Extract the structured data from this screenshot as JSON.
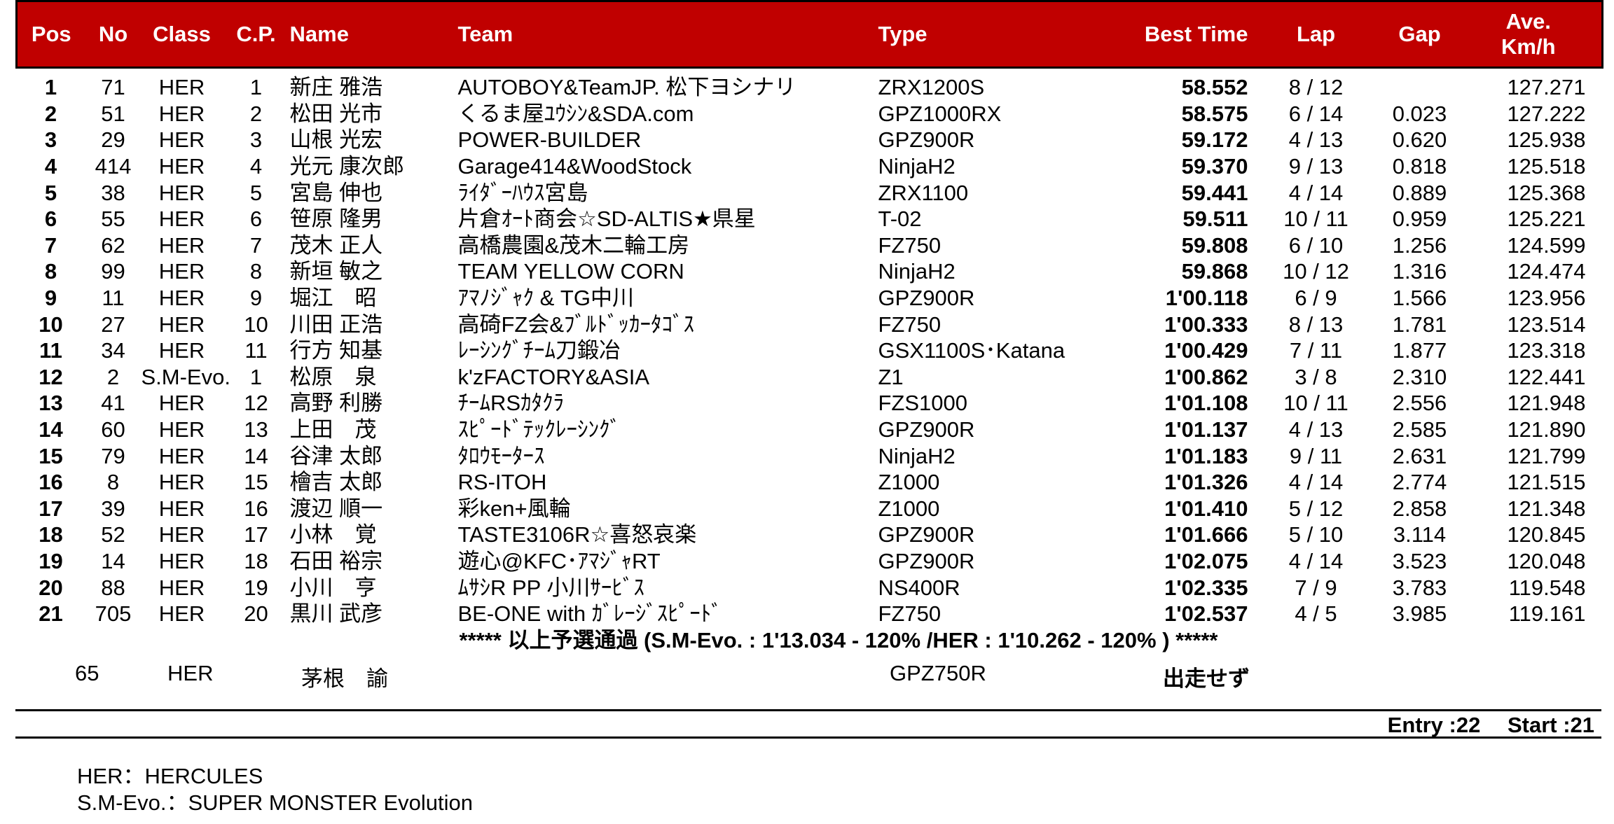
{
  "headers": {
    "pos": "Pos",
    "no": "No",
    "class": "Class",
    "cp": "C.P.",
    "name": "Name",
    "team": "Team",
    "type": "Type",
    "best_time": "Best Time",
    "lap": "Lap",
    "gap": "Gap",
    "avg_kmh_line1": "Ave.",
    "avg_kmh_line2": "Km/h"
  },
  "colors": {
    "header_bg": "#c00000",
    "header_text": "#ffffff"
  },
  "rows": [
    {
      "pos": "1",
      "no": "71",
      "cls": "HER",
      "cp": "1",
      "name": "新庄 雅浩",
      "team": "AUTOBOY&TeamJP. 松下ヨシナリ",
      "type": "ZRX1200S",
      "best": "58.552",
      "lap": "8 / 12",
      "gap": "",
      "avg": "127.271"
    },
    {
      "pos": "2",
      "no": "51",
      "cls": "HER",
      "cp": "2",
      "name": "松田 光市",
      "team": "くるま屋ﾕｳｼﾝ&SDA.com",
      "type": "GPZ1000RX",
      "best": "58.575",
      "lap": "6 / 14",
      "gap": "0.023",
      "avg": "127.222"
    },
    {
      "pos": "3",
      "no": "29",
      "cls": "HER",
      "cp": "3",
      "name": "山根 光宏",
      "team": "POWER-BUILDER",
      "type": "GPZ900R",
      "best": "59.172",
      "lap": "4 / 13",
      "gap": "0.620",
      "avg": "125.938"
    },
    {
      "pos": "4",
      "no": "414",
      "cls": "HER",
      "cp": "4",
      "name": "光元 康次郎",
      "team": "Garage414&WoodStock",
      "type": "NinjaH2",
      "best": "59.370",
      "lap": "9 / 13",
      "gap": "0.818",
      "avg": "125.518"
    },
    {
      "pos": "5",
      "no": "38",
      "cls": "HER",
      "cp": "5",
      "name": "宮島 伸也",
      "team": "ﾗｲﾀﾞｰﾊｳｽ宮島",
      "type": "ZRX1100",
      "best": "59.441",
      "lap": "4 / 14",
      "gap": "0.889",
      "avg": "125.368"
    },
    {
      "pos": "6",
      "no": "55",
      "cls": "HER",
      "cp": "6",
      "name": "笹原 隆男",
      "team": "片倉ｵｰﾄ商会☆SD-ALTIS★県星",
      "type": "T-02",
      "best": "59.511",
      "lap": "10 / 11",
      "gap": "0.959",
      "avg": "125.221"
    },
    {
      "pos": "7",
      "no": "62",
      "cls": "HER",
      "cp": "7",
      "name": "茂木 正人",
      "team": "高橋農園&茂木二輪工房",
      "type": "FZ750",
      "best": "59.808",
      "lap": "6 / 10",
      "gap": "1.256",
      "avg": "124.599"
    },
    {
      "pos": "8",
      "no": "99",
      "cls": "HER",
      "cp": "8",
      "name": "新垣 敏之",
      "team": "TEAM YELLOW CORN",
      "type": "NinjaH2",
      "best": "59.868",
      "lap": "10 / 12",
      "gap": "1.316",
      "avg": "124.474"
    },
    {
      "pos": "9",
      "no": "11",
      "cls": "HER",
      "cp": "9",
      "name": "堀江　昭",
      "team": "ｱﾏﾉｼﾞｬｸ & TG中川",
      "type": "GPZ900R",
      "best": "1'00.118",
      "lap": "6 / 9",
      "gap": "1.566",
      "avg": "123.956"
    },
    {
      "pos": "10",
      "no": "27",
      "cls": "HER",
      "cp": "10",
      "name": "川田 正浩",
      "team": "高碕FZ会&ﾌﾞﾙﾄﾞｯｶｰﾀｺﾞｽ",
      "type": "FZ750",
      "best": "1'00.333",
      "lap": "8 / 13",
      "gap": "1.781",
      "avg": "123.514"
    },
    {
      "pos": "11",
      "no": "34",
      "cls": "HER",
      "cp": "11",
      "name": "行方 知基",
      "team": "ﾚｰｼﾝｸﾞﾁｰﾑ刀鍛冶",
      "type": "GSX1100S･Katana",
      "best": "1'00.429",
      "lap": "7 / 11",
      "gap": "1.877",
      "avg": "123.318"
    },
    {
      "pos": "12",
      "no": "2",
      "cls": "S.M-Evo.",
      "cp": "1",
      "name": "松原　泉",
      "team": "k'zFACTORY&ASIA",
      "type": "Z1",
      "best": "1'00.862",
      "lap": "3 / 8",
      "gap": "2.310",
      "avg": "122.441"
    },
    {
      "pos": "13",
      "no": "41",
      "cls": "HER",
      "cp": "12",
      "name": "高野 利勝",
      "team": "ﾁｰﾑRSｶﾀｸﾗ",
      "type": "FZS1000",
      "best": "1'01.108",
      "lap": "10 / 11",
      "gap": "2.556",
      "avg": "121.948"
    },
    {
      "pos": "14",
      "no": "60",
      "cls": "HER",
      "cp": "13",
      "name": "上田　茂",
      "team": "ｽﾋﾟｰﾄﾞﾃｯｸﾚｰｼﾝｸﾞ",
      "type": "GPZ900R",
      "best": "1'01.137",
      "lap": "4 / 13",
      "gap": "2.585",
      "avg": "121.890"
    },
    {
      "pos": "15",
      "no": "79",
      "cls": "HER",
      "cp": "14",
      "name": "谷津 太郎",
      "team": "ﾀﾛｳﾓｰﾀｰｽ",
      "type": "NinjaH2",
      "best": "1'01.183",
      "lap": "9 / 11",
      "gap": "2.631",
      "avg": "121.799"
    },
    {
      "pos": "16",
      "no": "8",
      "cls": "HER",
      "cp": "15",
      "name": "檜吉 太郎",
      "team": "RS-ITOH",
      "type": "Z1000",
      "best": "1'01.326",
      "lap": "4 / 14",
      "gap": "2.774",
      "avg": "121.515"
    },
    {
      "pos": "17",
      "no": "39",
      "cls": "HER",
      "cp": "16",
      "name": "渡辺 順一",
      "team": "彩ken+風輪",
      "type": "Z1000",
      "best": "1'01.410",
      "lap": "5 / 12",
      "gap": "2.858",
      "avg": "121.348"
    },
    {
      "pos": "18",
      "no": "52",
      "cls": "HER",
      "cp": "17",
      "name": "小林　覚",
      "team": "TASTE3106R☆喜怒哀楽",
      "type": "GPZ900R",
      "best": "1'01.666",
      "lap": "5 / 10",
      "gap": "3.114",
      "avg": "120.845"
    },
    {
      "pos": "19",
      "no": "14",
      "cls": "HER",
      "cp": "18",
      "name": "石田 裕宗",
      "team": "遊心@KFC･ｱﾏｼﾞｬRT",
      "type": "GPZ900R",
      "best": "1'02.075",
      "lap": "4 / 14",
      "gap": "3.523",
      "avg": "120.048"
    },
    {
      "pos": "20",
      "no": "88",
      "cls": "HER",
      "cp": "19",
      "name": "小川　亨",
      "team": "ﾑｻｼR PP 小川ｻｰﾋﾞｽ",
      "type": "NS400R",
      "best": "1'02.335",
      "lap": "7 / 9",
      "gap": "3.783",
      "avg": "119.548"
    },
    {
      "pos": "21",
      "no": "705",
      "cls": "HER",
      "cp": "20",
      "name": "黒川 武彦",
      "team": "BE-ONE with ｶﾞﾚｰｼﾞｽﾋﾟｰﾄﾞ",
      "type": "FZ750",
      "best": "1'02.537",
      "lap": "4 / 5",
      "gap": "3.985",
      "avg": "119.161"
    }
  ],
  "qualification_note": "***** 以上予選通過 (S.M-Evo. : 1'13.034 - 120% /HER : 1'10.262 - 120% ) *****",
  "dns_row": {
    "no": "65",
    "cls": "HER",
    "name": "茅根　諭",
    "type": "GPZ750R",
    "status": "出走せず"
  },
  "summary": {
    "entry": "Entry :22",
    "start": "Start :21"
  },
  "legend": {
    "her": "HER：HERCULES",
    "smevo": "S.M-Evo.：SUPER MONSTER Evolution"
  }
}
